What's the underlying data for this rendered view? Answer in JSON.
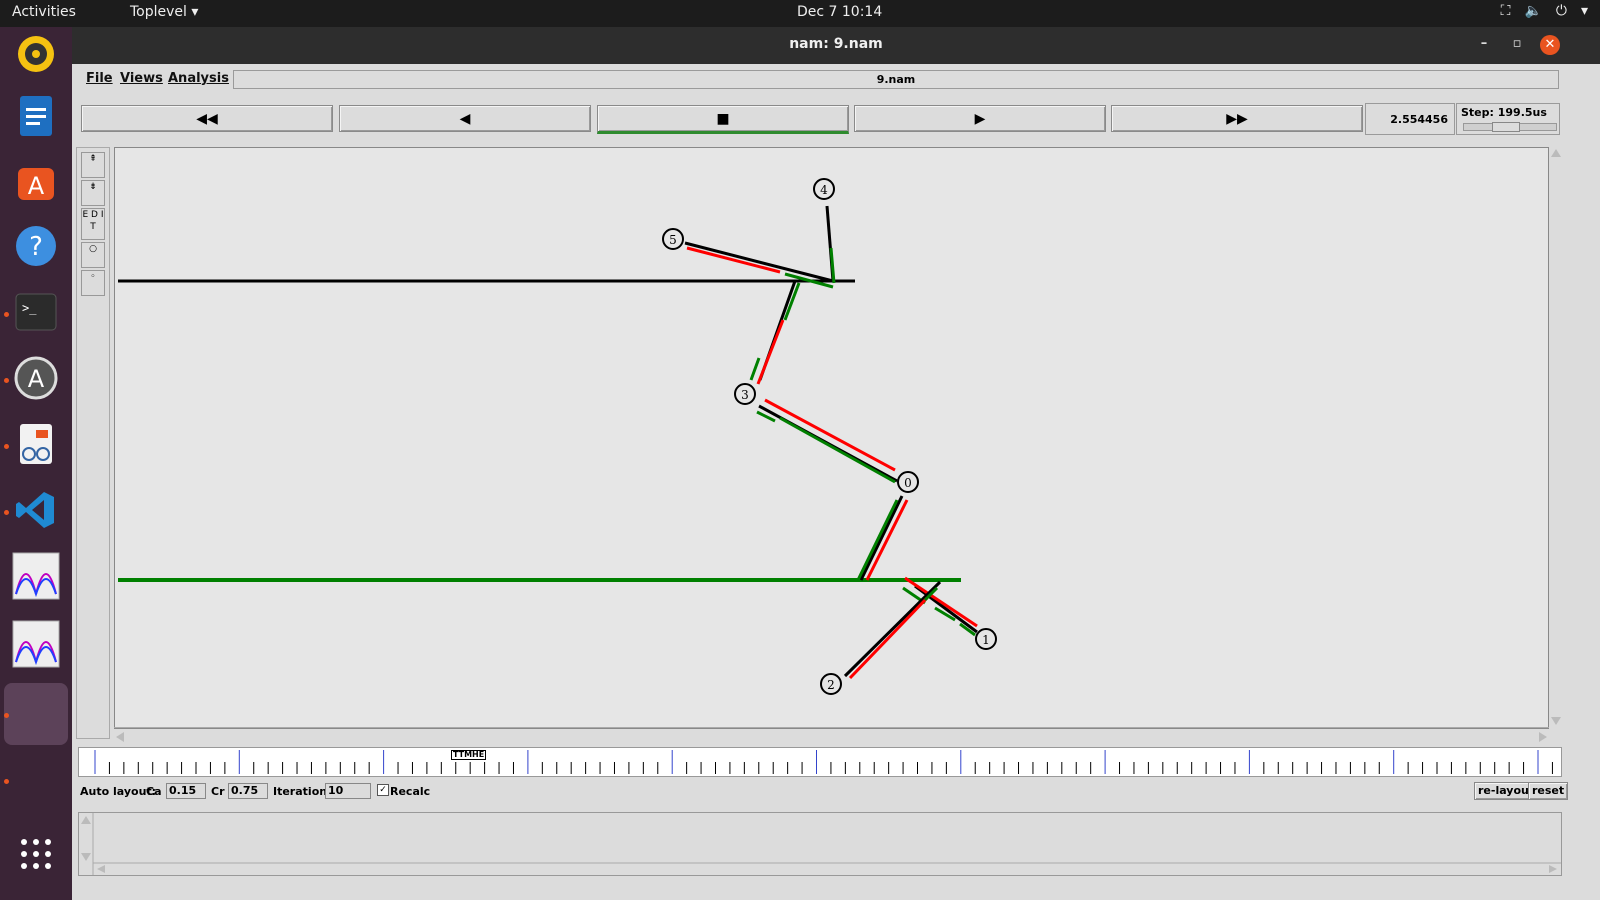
{
  "topbar": {
    "activities": "Activities",
    "app_menu": "Toplevel",
    "clock": "Dec 7  10:14"
  },
  "window": {
    "title": "nam: 9.nam"
  },
  "menu": {
    "file": "File",
    "views": "Views",
    "analysis": "Analysis",
    "filename": "9.nam"
  },
  "playback": {
    "time": "2.554456",
    "step": "Step: 199.5us"
  },
  "sidetools": {
    "edit": "E D I T"
  },
  "network": {
    "nodes": [
      {
        "id": "0",
        "label": "0"
      },
      {
        "id": "1",
        "label": "1"
      },
      {
        "id": "2",
        "label": "2"
      },
      {
        "id": "3",
        "label": "3"
      },
      {
        "id": "4",
        "label": "4"
      },
      {
        "id": "5",
        "label": "5"
      }
    ],
    "colors": {
      "link": "#000000",
      "packet_red": "#ff0000",
      "packet_green": "#008000",
      "lan_green": "#008000"
    }
  },
  "timeline": {
    "marker_label": "TTMHE"
  },
  "autolayout": {
    "label": "Auto layout:",
    "ca_label": "Ca",
    "ca_value": "0.15",
    "cr_label": "Cr",
    "cr_value": "0.75",
    "iterations_label": "Iterations",
    "iterations_value": "10",
    "recalc_label": "Recalc",
    "relayout_label": "re-layout",
    "reset_label": "reset"
  }
}
